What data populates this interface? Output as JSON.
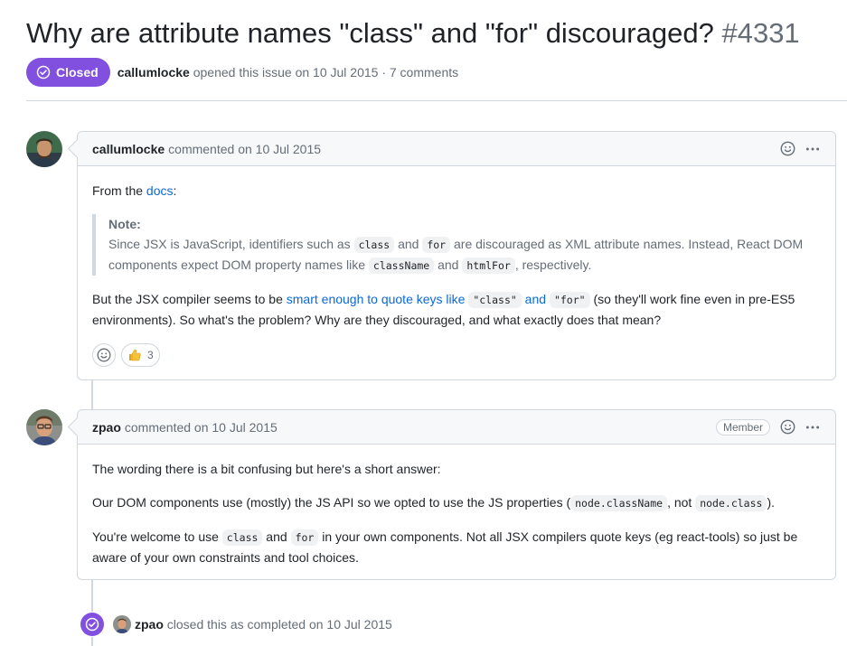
{
  "issue": {
    "title": "Why are attribute names \"class\" and \"for\" discouraged?",
    "number": "#4331",
    "status": "Closed",
    "author": "callumlocke",
    "opened_text": "opened this issue on 10 Jul 2015 · 7 comments",
    "status_color": "#8250df"
  },
  "comments": [
    {
      "author": "callumlocke",
      "action": "commented on 10 Jul 2015",
      "p1_pre": "From the ",
      "p1_link": "docs",
      "p1_post": ":",
      "note_title": "Note:",
      "note_1": "Since JSX is JavaScript, identifiers such as ",
      "note_code_1": "class",
      "note_2": " and ",
      "note_code_2": "for",
      "note_3": " are discouraged as XML attribute names. Instead, React DOM components expect DOM property names like ",
      "note_code_3": "className",
      "note_4": " and ",
      "note_code_4": "htmlFor",
      "note_5": ", respectively.",
      "p2_pre": "But the JSX compiler seems to be ",
      "p2_link_1": "smart enough to quote keys like ",
      "p2_link_code_1": "\"class\"",
      "p2_link_2": " and ",
      "p2_link_code_2": "\"for\"",
      "p2_post": " (so they'll work fine even in pre-ES5 environments). So what's the problem? Why are they discouraged, and what exactly does that mean?",
      "reaction_count": "3"
    },
    {
      "author": "zpao",
      "action": "commented on 10 Jul 2015",
      "role": "Member",
      "p1": "The wording there is a bit confusing but here's a short answer:",
      "p2_pre": "Our DOM components use (mostly) the JS API so we opted to use the JS properties (",
      "p2_code_1": "node.className",
      "p2_mid": ", not ",
      "p2_code_2": "node.class",
      "p2_post": ").",
      "p3_pre": "You're welcome to use ",
      "p3_code_1": "class",
      "p3_mid": " and ",
      "p3_code_2": "for",
      "p3_post": " in your own components. Not all JSX compilers quote keys (eg react-tools) so just be aware of your own constraints and tool choices."
    }
  ],
  "event": {
    "actor": "zpao",
    "text": "closed this as completed on 10 Jul 2015"
  },
  "icons": [
    "check-circle-icon",
    "smiley-icon",
    "kebab-icon",
    "thumbs-up-icon"
  ]
}
